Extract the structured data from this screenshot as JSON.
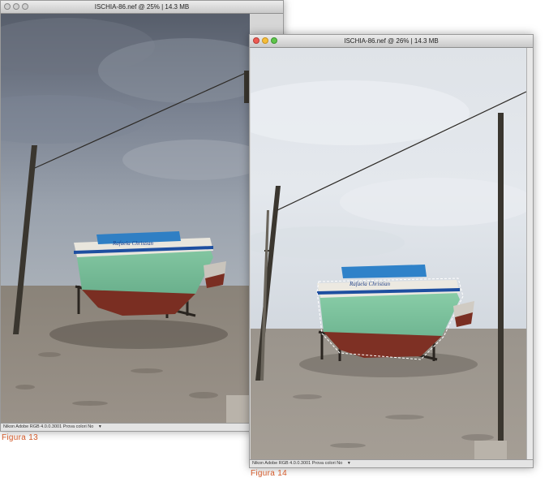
{
  "window1": {
    "title": "ISCHIA-86.nef @ 25% | 14.3 MB",
    "status": "Nikon Adobe RGB 4.0.0.3001  Prova colori No",
    "status_arrow": "▼"
  },
  "window2": {
    "title": "ISCHIA-86.nef @ 26% | 14.3 MB",
    "status": "Nikon Adobe RGB 4.0.0.3001  Prova colori No",
    "status_arrow": "▼"
  },
  "captions": {
    "fig13": "Figura 13",
    "fig14": "Figura 14"
  },
  "boat_name": "Rafaela  Christian",
  "colors": {
    "accent_caption": "#d35a2a",
    "hull_green": "#7fbf9c",
    "hull_red": "#7a2e22",
    "trim_blue": "#1e4fa0"
  }
}
